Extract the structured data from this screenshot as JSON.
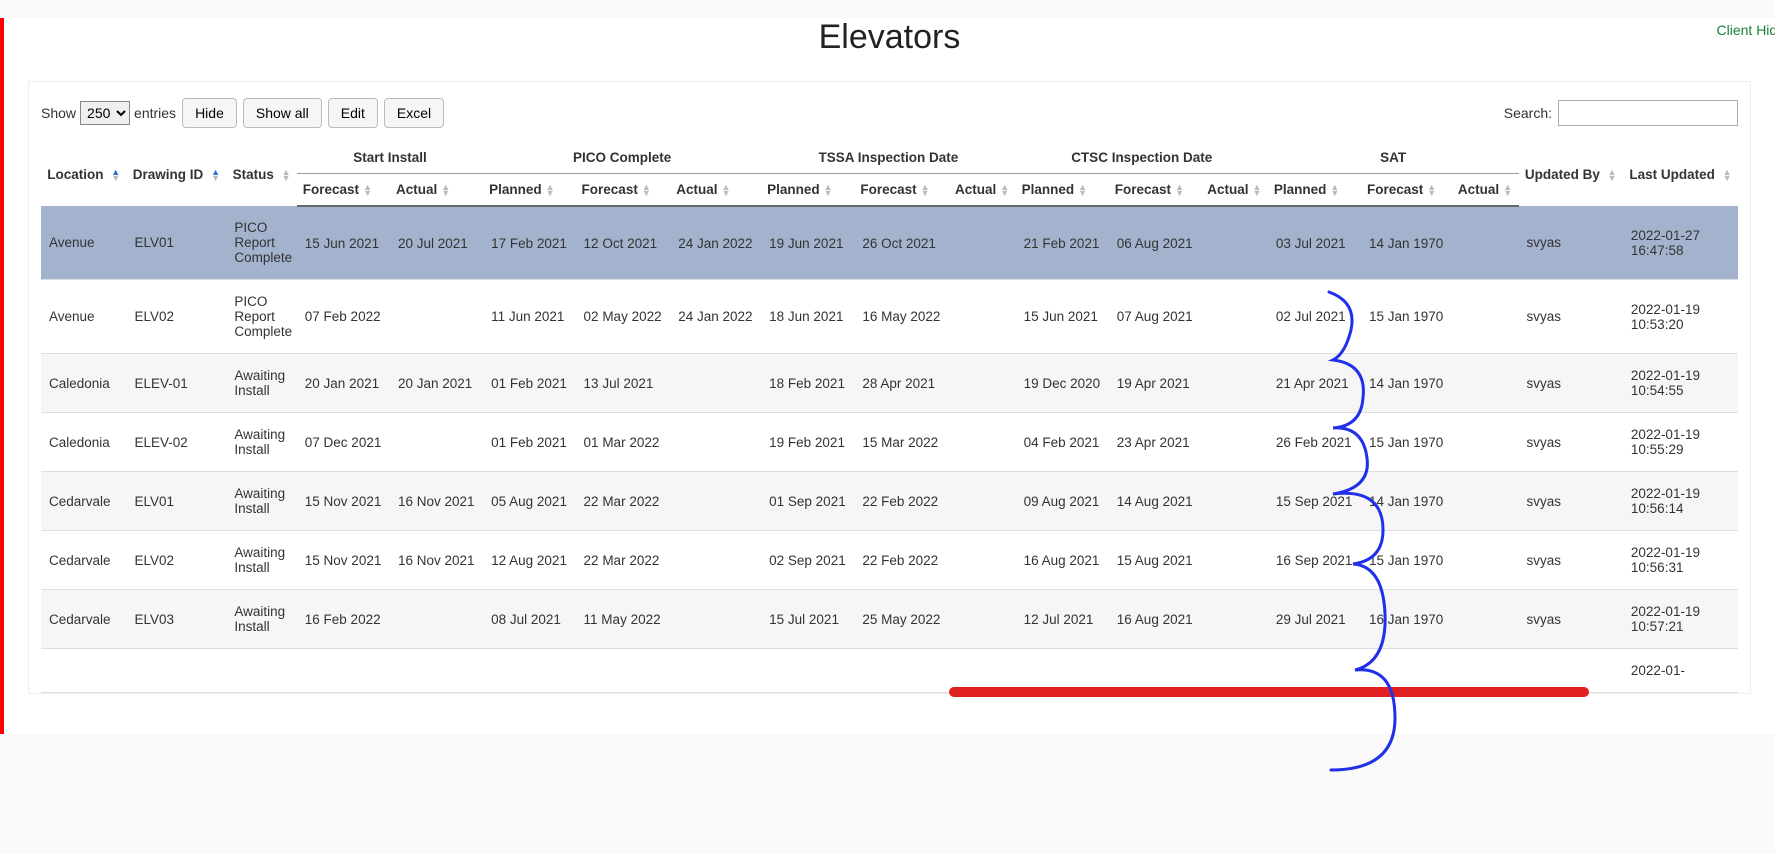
{
  "top_link": "Client Hidd",
  "title": "Elevators",
  "controls": {
    "show_label_prefix": "Show",
    "show_label_suffix": "entries",
    "entries_value": "250",
    "hide": "Hide",
    "show_all": "Show all",
    "edit": "Edit",
    "excel": "Excel",
    "search_label": "Search:"
  },
  "columns": {
    "location": "Location",
    "drawing_id": "Drawing ID",
    "status": "Status",
    "updated_by": "Updated By",
    "last_updated": "Last Updated",
    "groups": {
      "start_install": "Start Install",
      "pico_complete": "PICO Complete",
      "tssa": "TSSA Inspection Date",
      "ctsc": "CTSC Inspection Date",
      "sat": "SAT"
    },
    "sub": {
      "forecast": "Forecast",
      "actual": "Actual",
      "planned": "Planned"
    }
  },
  "rows": [
    {
      "highlight": true,
      "location": "Avenue",
      "drawing_id": "ELV01",
      "status": "PICO Report Complete",
      "si_forecast": "15 Jun 2021",
      "si_actual": "20 Jul 2021",
      "pc_planned": "17 Feb 2021",
      "pc_forecast": "12 Oct 2021",
      "pc_actual": "24 Jan 2022",
      "ts_planned": "19 Jun 2021",
      "ts_forecast": "26 Oct 2021",
      "ts_actual": "",
      "ct_planned": "21 Feb 2021",
      "ct_forecast": "06 Aug 2021",
      "ct_actual": "",
      "sat_planned": "03 Jul 2021",
      "sat_forecast": "14 Jan 1970",
      "sat_actual": "",
      "updated_by": "svyas",
      "last_updated": "2022-01-27 16:47:58"
    },
    {
      "location": "Avenue",
      "drawing_id": "ELV02",
      "status": "PICO Report Complete",
      "si_forecast": "07 Feb 2022",
      "si_actual": "",
      "pc_planned": "11 Jun 2021",
      "pc_forecast": "02 May 2022",
      "pc_actual": "24 Jan 2022",
      "ts_planned": "18 Jun 2021",
      "ts_forecast": "16 May 2022",
      "ts_actual": "",
      "ct_planned": "15 Jun 2021",
      "ct_forecast": "07 Aug 2021",
      "ct_actual": "",
      "sat_planned": "02 Jul 2021",
      "sat_forecast": "15 Jan 1970",
      "sat_actual": "",
      "updated_by": "svyas",
      "last_updated": "2022-01-19 10:53:20"
    },
    {
      "location": "Caledonia",
      "drawing_id": "ELEV-01",
      "status": "Awaiting Install",
      "si_forecast": "20 Jan 2021",
      "si_actual": "20 Jan 2021",
      "pc_planned": "01 Feb 2021",
      "pc_forecast": "13 Jul 2021",
      "pc_actual": "",
      "ts_planned": "18 Feb 2021",
      "ts_forecast": "28 Apr 2021",
      "ts_actual": "",
      "ct_planned": "19 Dec 2020",
      "ct_forecast": "19 Apr 2021",
      "ct_actual": "",
      "sat_planned": "21 Apr 2021",
      "sat_forecast": "14 Jan 1970",
      "sat_actual": "",
      "updated_by": "svyas",
      "last_updated": "2022-01-19 10:54:55"
    },
    {
      "location": "Caledonia",
      "drawing_id": "ELEV-02",
      "status": "Awaiting Install",
      "si_forecast": "07 Dec 2021",
      "si_actual": "",
      "pc_planned": "01 Feb 2021",
      "pc_forecast": "01 Mar 2022",
      "pc_actual": "",
      "ts_planned": "19 Feb 2021",
      "ts_forecast": "15 Mar 2022",
      "ts_actual": "",
      "ct_planned": "04 Feb 2021",
      "ct_forecast": "23 Apr 2021",
      "ct_actual": "",
      "sat_planned": "26 Feb 2021",
      "sat_forecast": "15 Jan 1970",
      "sat_actual": "",
      "updated_by": "svyas",
      "last_updated": "2022-01-19 10:55:29"
    },
    {
      "location": "Cedarvale",
      "drawing_id": "ELV01",
      "status": "Awaiting Install",
      "si_forecast": "15 Nov 2021",
      "si_actual": "16 Nov 2021",
      "pc_planned": "05 Aug 2021",
      "pc_forecast": "22 Mar 2022",
      "pc_actual": "",
      "ts_planned": "01 Sep 2021",
      "ts_forecast": "22 Feb 2022",
      "ts_actual": "",
      "ct_planned": "09 Aug 2021",
      "ct_forecast": "14 Aug 2021",
      "ct_actual": "",
      "sat_planned": "15 Sep 2021",
      "sat_forecast": "14 Jan 1970",
      "sat_actual": "",
      "updated_by": "svyas",
      "last_updated": "2022-01-19 10:56:14"
    },
    {
      "location": "Cedarvale",
      "drawing_id": "ELV02",
      "status": "Awaiting Install",
      "si_forecast": "15 Nov 2021",
      "si_actual": "16 Nov 2021",
      "pc_planned": "12 Aug 2021",
      "pc_forecast": "22 Mar 2022",
      "pc_actual": "",
      "ts_planned": "02 Sep 2021",
      "ts_forecast": "22 Feb 2022",
      "ts_actual": "",
      "ct_planned": "16 Aug 2021",
      "ct_forecast": "15 Aug 2021",
      "ct_actual": "",
      "sat_planned": "16 Sep 2021",
      "sat_forecast": "15 Jan 1970",
      "sat_actual": "",
      "updated_by": "svyas",
      "last_updated": "2022-01-19 10:56:31"
    },
    {
      "location": "Cedarvale",
      "drawing_id": "ELV03",
      "status": "Awaiting Install",
      "si_forecast": "16 Feb 2022",
      "si_actual": "",
      "pc_planned": "08 Jul 2021",
      "pc_forecast": "11 May 2022",
      "pc_actual": "",
      "ts_planned": "15 Jul 2021",
      "ts_forecast": "25 May 2022",
      "ts_actual": "",
      "ct_planned": "12 Jul 2021",
      "ct_forecast": "16 Aug 2021",
      "ct_actual": "",
      "sat_planned": "29 Jul 2021",
      "sat_forecast": "16 Jan 1970",
      "sat_actual": "",
      "updated_by": "svyas",
      "last_updated": "2022-01-19 10:57:21"
    },
    {
      "partial": true,
      "location": "",
      "drawing_id": "",
      "status": "",
      "si_forecast": "",
      "si_actual": "",
      "pc_planned": "",
      "pc_forecast": "",
      "pc_actual": "",
      "ts_planned": "",
      "ts_forecast": "",
      "ts_actual": "",
      "ct_planned": "",
      "ct_forecast": "",
      "ct_actual": "",
      "sat_planned": "",
      "sat_forecast": "",
      "sat_actual": "",
      "updated_by": "",
      "last_updated": "2022-01-"
    }
  ]
}
